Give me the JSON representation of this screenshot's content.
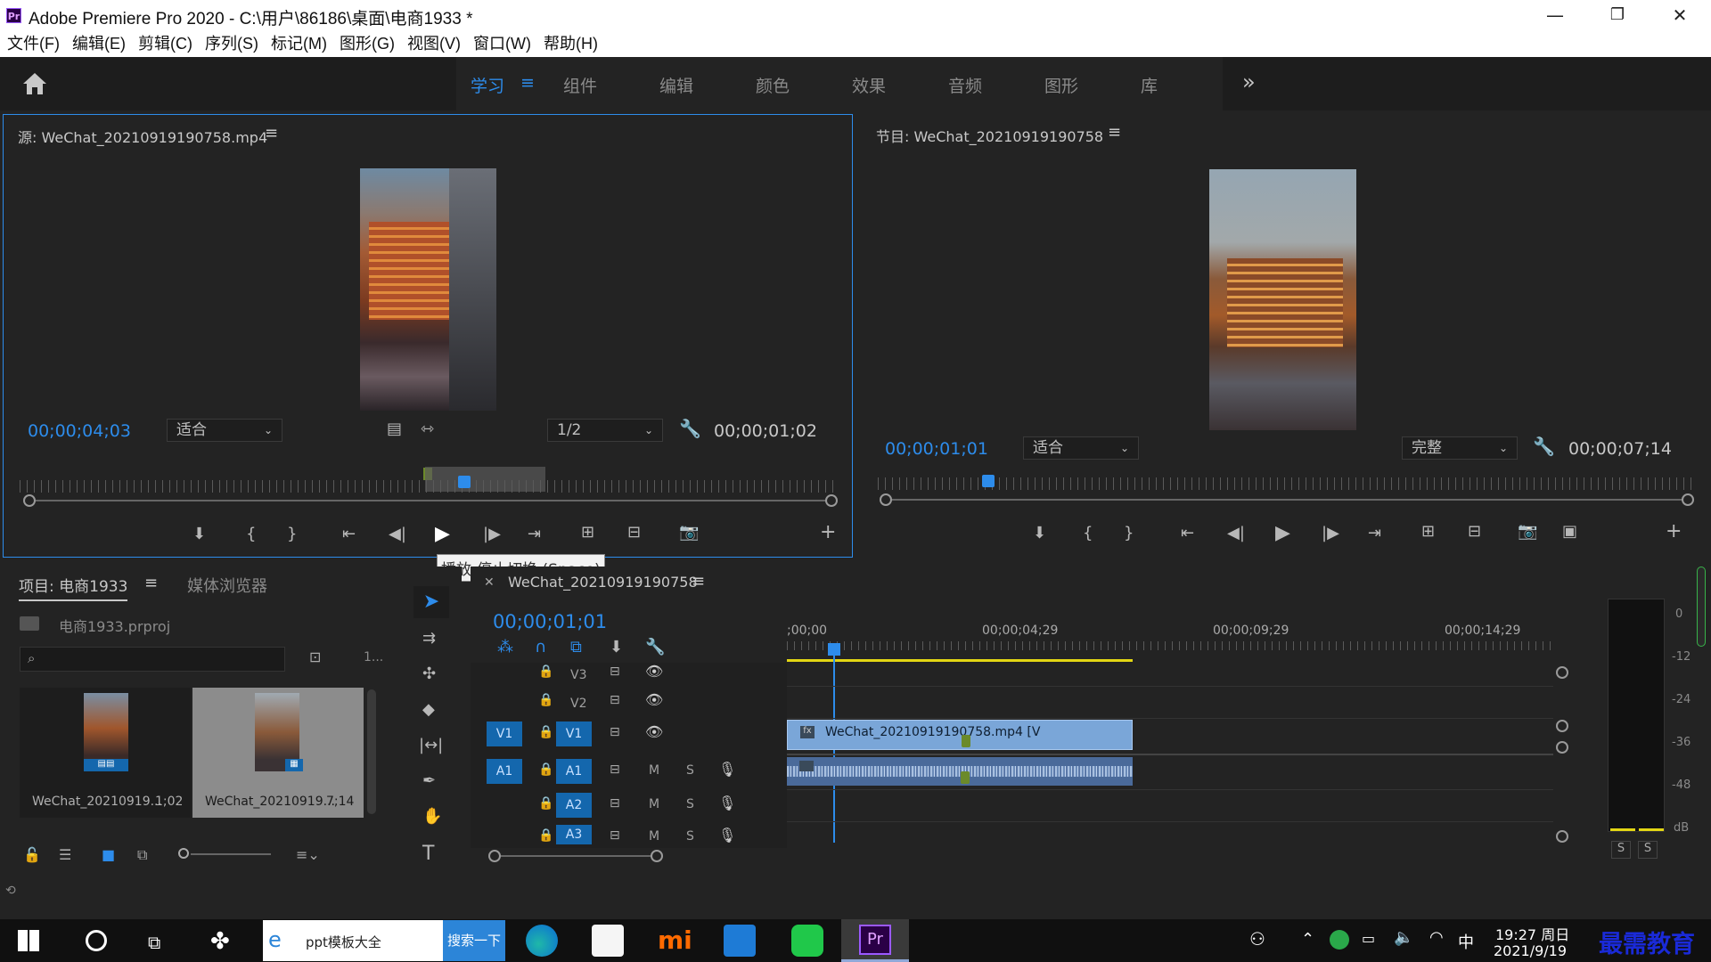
{
  "titlebar": {
    "app_icon": "Pr",
    "title": "Adobe Premiere Pro 2020 - C:\\用户\\86186\\桌面\\电商1933 *",
    "minimize_icon": "minimize-icon",
    "maximize_icon": "restore-icon",
    "close_icon": "close-icon"
  },
  "menu": [
    "文件(F)",
    "编辑(E)",
    "剪辑(C)",
    "序列(S)",
    "标记(M)",
    "图形(G)",
    "视图(V)",
    "窗口(W)",
    "帮助(H)"
  ],
  "workspaces": {
    "items": [
      "学习",
      "组件",
      "编辑",
      "颜色",
      "效果",
      "音频",
      "图形",
      "库"
    ],
    "active": "学习",
    "more": "»"
  },
  "source_monitor": {
    "title": "源: WeChat_20210919190758.mp4",
    "timecode": "00;00;04;03",
    "fit": "适合",
    "resolution": "1/2",
    "duration": "00;00;01;02",
    "tooltip": "播放-停止切换 (Space)"
  },
  "program_monitor": {
    "title": "节目: WeChat_20210919190758",
    "timecode": "00;00;01;01",
    "fit": "适合",
    "quality": "完整",
    "duration": "00;00;07;14"
  },
  "project": {
    "tab_project": "项目: 电商1933",
    "tab_media": "媒体浏览器",
    "file": "电商1933.prproj",
    "count": "1...",
    "items": [
      {
        "name": "WeChat_20210919...",
        "duration": "1;02"
      },
      {
        "name": "WeChat_20210919...",
        "duration": "7;14"
      }
    ]
  },
  "timeline": {
    "title": "WeChat_20210919190758",
    "timecode": "00;00;01;01",
    "ticks": [
      ";00;00",
      "00;00;04;29",
      "00;00;09;29",
      "00;00;14;29"
    ],
    "video_tracks": [
      "V3",
      "V2",
      "V1"
    ],
    "audio_tracks": [
      "A1",
      "A2",
      "A3"
    ],
    "source_v": "V1",
    "source_a": "A1",
    "clip_label": "WeChat_20210919190758.mp4 [V",
    "m_label": "M",
    "s_label": "S"
  },
  "meter": {
    "scale": [
      "0",
      "-12",
      "-24",
      "-36",
      "-48",
      "dB"
    ],
    "solo": [
      "S",
      "S"
    ]
  },
  "taskbar": {
    "search_text": "ppt模板大全",
    "search_button": "搜索一下",
    "time": "19:27 周日",
    "date": "2021/9/19",
    "ime": "中",
    "watermark": "最需教育"
  },
  "colors": {
    "accent": "#2d8ceb",
    "track": "#1467ad",
    "clip": "#7aa6d8",
    "workarea": "#e3d614"
  }
}
